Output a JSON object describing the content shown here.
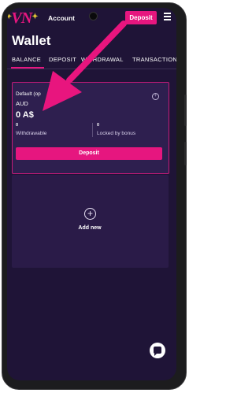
{
  "header": {
    "logo_text": "VN",
    "account_label": "Account",
    "deposit_label": "Deposit"
  },
  "wallet": {
    "title": "Wallet",
    "tabs": [
      {
        "label": "BALANCE",
        "active": true
      },
      {
        "label": "DEPOSIT",
        "active": false
      },
      {
        "label": "WITHDRAWAL",
        "active": false
      },
      {
        "label": "TRANSACTIONS",
        "active": false
      }
    ]
  },
  "balance_card": {
    "label": "Default (op",
    "currency": "AUD",
    "amount": "0 A$",
    "withdrawable_value": "0",
    "withdrawable_label": "Withdrawable",
    "locked_value": "0",
    "locked_label": "Locked by bonus",
    "deposit_button": "Deposit"
  },
  "add_new": {
    "label": "Add new"
  },
  "colors": {
    "accent": "#e6167f",
    "background": "#1f1437",
    "card": "#2e1f4f",
    "annotation_arrow": "#e8157e"
  },
  "icons": [
    "star-icon",
    "menu-icon",
    "plus-circle-icon",
    "add-circle-icon",
    "chat-icon",
    "annotation-arrow"
  ]
}
